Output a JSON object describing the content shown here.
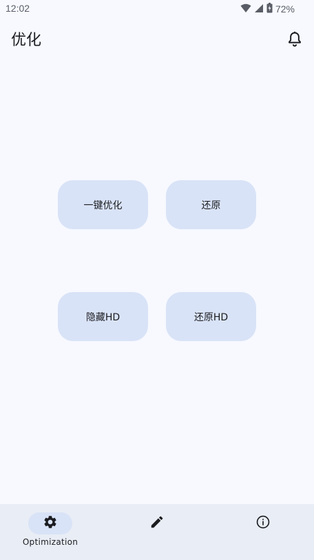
{
  "status_bar": {
    "time": "12:02",
    "battery": "72%",
    "icons": [
      "wifi-icon",
      "signal-icon",
      "battery-icon"
    ]
  },
  "header": {
    "title": "优化",
    "action_icon": "bell-icon"
  },
  "main": {
    "buttons": [
      {
        "label": "一键优化"
      },
      {
        "label": "还原"
      },
      {
        "label": "隐藏HD"
      },
      {
        "label": "还原HD"
      }
    ]
  },
  "bottom_nav": {
    "items": [
      {
        "label": "Optimization",
        "icon": "gear-icon",
        "active": true
      },
      {
        "label": "",
        "icon": "edit-icon",
        "active": false
      },
      {
        "label": "",
        "icon": "info-icon",
        "active": false
      }
    ]
  },
  "colors": {
    "background": "#f7f9ff",
    "button": "#d9e3f7",
    "nav_background": "#e9edf5",
    "text": "#1b1c20"
  }
}
